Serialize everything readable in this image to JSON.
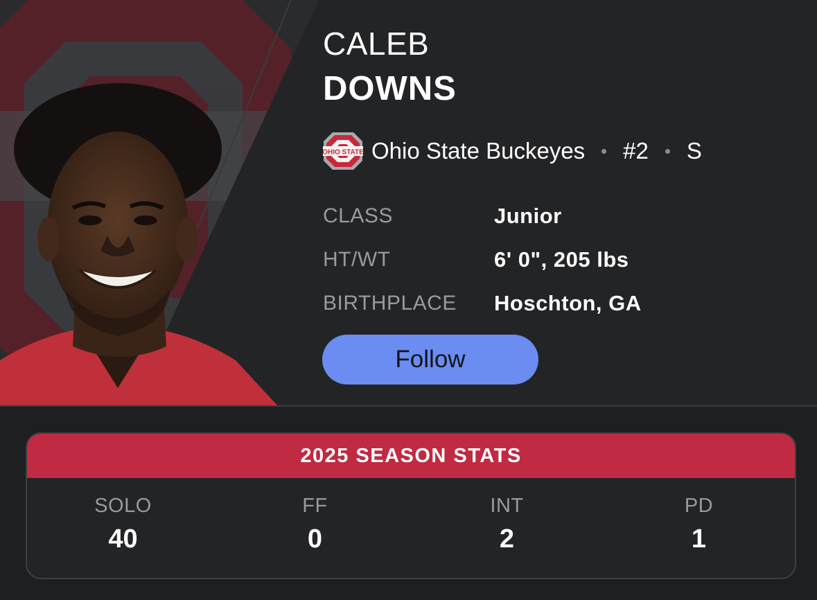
{
  "player": {
    "first_name": "CALEB",
    "last_name": "DOWNS",
    "team": "Ohio State Buckeyes",
    "number": "#2",
    "position": "S"
  },
  "team_logo": {
    "icon": "ohio-state-logo-icon",
    "text": "OHIO STATE"
  },
  "info": {
    "class_label": "CLASS",
    "class_value": "Junior",
    "htwt_label": "HT/WT",
    "htwt_value": "6' 0\", 205 lbs",
    "birthplace_label": "BIRTHPLACE",
    "birthplace_value": "Hoschton, GA"
  },
  "follow_label": "Follow",
  "stats": {
    "title": "2025 SEASON STATS",
    "items": [
      {
        "label": "SOLO",
        "value": "40"
      },
      {
        "label": "FF",
        "value": "0"
      },
      {
        "label": "INT",
        "value": "2"
      },
      {
        "label": "PD",
        "value": "1"
      }
    ]
  },
  "colors": {
    "accent_red": "#c02a42",
    "follow_blue": "#6b8cf0",
    "background": "#232426"
  }
}
